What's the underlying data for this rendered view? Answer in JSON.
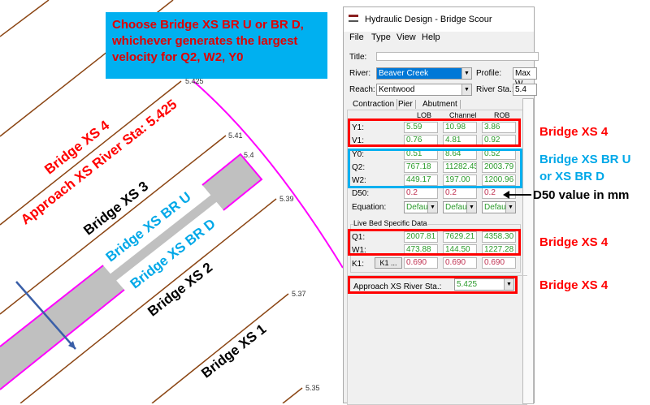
{
  "callout": {
    "text": "Choose Bridge XS BR U or BR D, whichever generates the largest velocity for Q2, W2, Y0"
  },
  "map": {
    "stations": [
      "5.425",
      "5.41",
      "5.4",
      "5.39",
      "5.37",
      "5.35"
    ],
    "labels": {
      "xs4": "Bridge XS 4",
      "approach": "Approach XS River Sta: 5.425",
      "xs3": "Bridge XS 3",
      "bru": "Bridge XS BR U",
      "brd": "Bridge XS BR D",
      "xs2": "Bridge XS 2",
      "xs1": "Bridge XS 1"
    },
    "colors": {
      "xs_line": "#8b4513",
      "bank": "#ff00ff",
      "bridge": "#c0c0c0",
      "flow_arrow": "#3a5fa8"
    }
  },
  "window": {
    "title": "Hydraulic Design - Bridge Scour",
    "menu": [
      "File",
      "Type",
      "View",
      "Help"
    ],
    "title_label": "Title:",
    "title_value": "",
    "river_label": "River:",
    "river_value": "Beaver Creek",
    "profile_label": "Profile:",
    "profile_value": "Max W",
    "reach_label": "Reach:",
    "reach_value": "Kentwood",
    "station_label": "River Sta.:",
    "station_value": "5.4",
    "tabs": [
      "Contraction",
      "Pier",
      "Abutment"
    ],
    "columns": [
      "LOB",
      "Channel",
      "ROB"
    ],
    "rows": [
      {
        "label": "Y1:",
        "values": [
          "5.59",
          "10.98",
          "3.86"
        ]
      },
      {
        "label": "V1:",
        "values": [
          "0.76",
          "4.81",
          "0.92"
        ]
      },
      {
        "label": "Y0:",
        "values": [
          "0.51",
          "8.64",
          "0.52"
        ]
      },
      {
        "label": "Q2:",
        "values": [
          "767.18",
          "11282.45",
          "2003.79"
        ]
      },
      {
        "label": "W2:",
        "values": [
          "449.17",
          "197.00",
          "1200.96"
        ]
      },
      {
        "label": "D50:",
        "values": [
          "0.2",
          "0.2",
          "0.2"
        ]
      }
    ],
    "equation_label": "Equation:",
    "equation_values": [
      "Defau",
      "Defau",
      "Defau"
    ],
    "live_bed_label": "Live Bed Specific Data",
    "live_rows": [
      {
        "label": "Q1:",
        "values": [
          "2007.81",
          "7629.21",
          "4358.30"
        ]
      },
      {
        "label": "W1:",
        "values": [
          "473.88",
          "144.50",
          "1227.28"
        ]
      }
    ],
    "k1_label": "K1:",
    "k1_button": "K1 ...",
    "k1_values": [
      "0.690",
      "0.690",
      "0.690"
    ],
    "approach_label": "Approach XS River Sta.:",
    "approach_value": "5.425"
  },
  "notes": {
    "n1": "Bridge XS 4",
    "n2a": "Bridge XS BR U",
    "n2b": "or XS BR D",
    "n3": "D50 value  in mm",
    "n4": "Bridge XS 4",
    "n5": "Bridge XS 4"
  }
}
